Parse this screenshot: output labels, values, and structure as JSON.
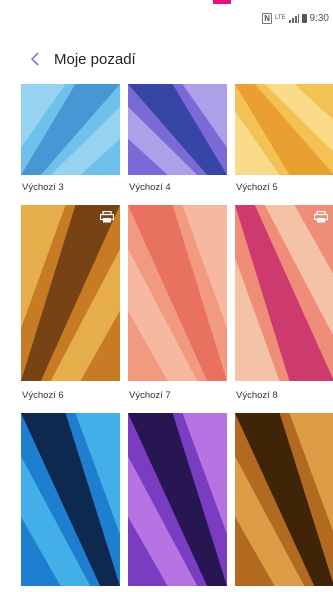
{
  "header": {
    "title": "Moje pozadí",
    "back_icon": "chevron-left-icon",
    "accent": "#7b7bd6"
  },
  "status": {
    "icons": [
      "nfc-icon",
      "lte-icon",
      "signal-icon",
      "battery-icon"
    ],
    "nfc_text": "N",
    "lte_text": "LTE",
    "time": "9:30"
  },
  "wallpapers": [
    {
      "label": "Výchozí 3",
      "colors": [
        "#3f8fd0",
        "#6fc0ea",
        "#a8dcf2"
      ],
      "print_icon": false
    },
    {
      "label": "Výchozí 4",
      "colors": [
        "#2c3f9e",
        "#7a6ad8",
        "#c3b8f0"
      ],
      "print_icon": false
    },
    {
      "label": "Výchozí 5",
      "colors": [
        "#e79a2b",
        "#f4c154",
        "#fbe6a0"
      ],
      "print_icon": false
    },
    {
      "label": "Výchozí 6",
      "colors": [
        "#6a3a12",
        "#c77b24",
        "#f3c45b"
      ],
      "print_icon": true
    },
    {
      "label": "Výchozí 7",
      "colors": [
        "#e86a5a",
        "#f29a80",
        "#f8c6ac"
      ],
      "print_icon": false
    },
    {
      "label": "Výchozí 8",
      "colors": [
        "#c72c6c",
        "#ef8d78",
        "#f7d8b8"
      ],
      "print_icon": true
    },
    {
      "label": "",
      "colors": [
        "#0b1a3a",
        "#1e7fd0",
        "#52c3f2"
      ],
      "print_icon": false
    },
    {
      "label": "",
      "colors": [
        "#1a0f3e",
        "#7a3cc0",
        "#d08af0"
      ],
      "print_icon": false
    },
    {
      "label": "",
      "colors": [
        "#2a1705",
        "#b26a20",
        "#f0b458"
      ],
      "print_icon": false
    }
  ]
}
